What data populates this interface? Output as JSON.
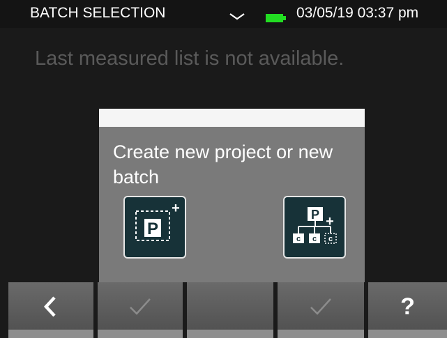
{
  "status_bar": {
    "title": "BATCH SELECTION",
    "chevron_icon": "chevron-down-icon",
    "battery_icon": "battery-icon",
    "battery_color": "#22dd22",
    "datetime": "03/05/19 03:37 pm"
  },
  "main": {
    "message": "Last measured list is not available."
  },
  "dialog": {
    "text": "Create new project or new batch",
    "tiles": [
      {
        "icon": "new-project-icon",
        "letter": "P"
      },
      {
        "icon": "new-batch-icon",
        "letter": "P",
        "sub_letter": "c"
      }
    ]
  },
  "bottom_bar": {
    "buttons": [
      {
        "icon": "back-chevron-icon",
        "enabled": true
      },
      {
        "icon": "checkmark-icon",
        "enabled": false
      },
      {
        "icon": "",
        "enabled": false
      },
      {
        "icon": "checkmark-icon",
        "enabled": false
      },
      {
        "label": "?",
        "icon": "help-icon",
        "enabled": true
      }
    ]
  },
  "colors": {
    "background": "#1a1a1a",
    "dialog": "#7a7a7a",
    "tile": "#173238",
    "muted_text": "#5a5a5a"
  }
}
